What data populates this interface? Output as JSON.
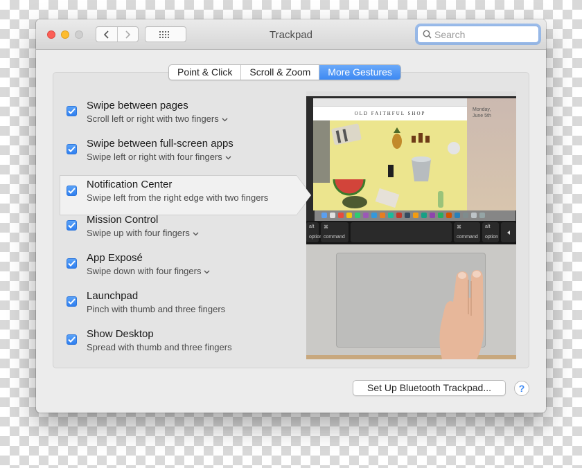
{
  "window": {
    "title": "Trackpad"
  },
  "toolbar": {
    "search_placeholder": "Search"
  },
  "tabs": [
    {
      "label": "Point & Click",
      "active": false
    },
    {
      "label": "Scroll & Zoom",
      "active": false
    },
    {
      "label": "More Gestures",
      "active": true
    }
  ],
  "gestures": [
    {
      "title": "Swipe between pages",
      "subtitle": "Scroll left or right with two fingers",
      "checked": true,
      "has_menu": true
    },
    {
      "title": "Swipe between full-screen apps",
      "subtitle": "Swipe left or right with four fingers",
      "checked": true,
      "has_menu": true
    },
    {
      "title": "Notification Center",
      "subtitle": "Swipe left from the right edge with two fingers",
      "checked": true,
      "has_menu": false,
      "selected": true
    },
    {
      "title": "Mission Control",
      "subtitle": "Swipe up with four fingers",
      "checked": true,
      "has_menu": true
    },
    {
      "title": "App Exposé",
      "subtitle": "Swipe down with four fingers",
      "checked": true,
      "has_menu": true
    },
    {
      "title": "Launchpad",
      "subtitle": "Pinch with thumb and three fingers",
      "checked": true,
      "has_menu": false
    },
    {
      "title": "Show Desktop",
      "subtitle": "Spread with thumb and three fingers",
      "checked": true,
      "has_menu": false
    }
  ],
  "preview": {
    "shop_name": "OLD FAITHFUL SHOP",
    "notification_day": "Monday,",
    "notification_date": "June 5th",
    "keys": {
      "left_top": "alt",
      "left_bottom": "option",
      "left_cmd_top": "⌘",
      "left_cmd_bottom": "command",
      "right_cmd_top": "⌘",
      "right_cmd_bottom": "command",
      "right_top": "alt",
      "right_bottom": "option"
    }
  },
  "footer": {
    "bluetooth_button": "Set Up Bluetooth Trackpad...",
    "help_button": "?"
  },
  "colors": {
    "accent": "#3d89f3",
    "close": "#fc5f57",
    "minimize": "#fdbc2e"
  }
}
